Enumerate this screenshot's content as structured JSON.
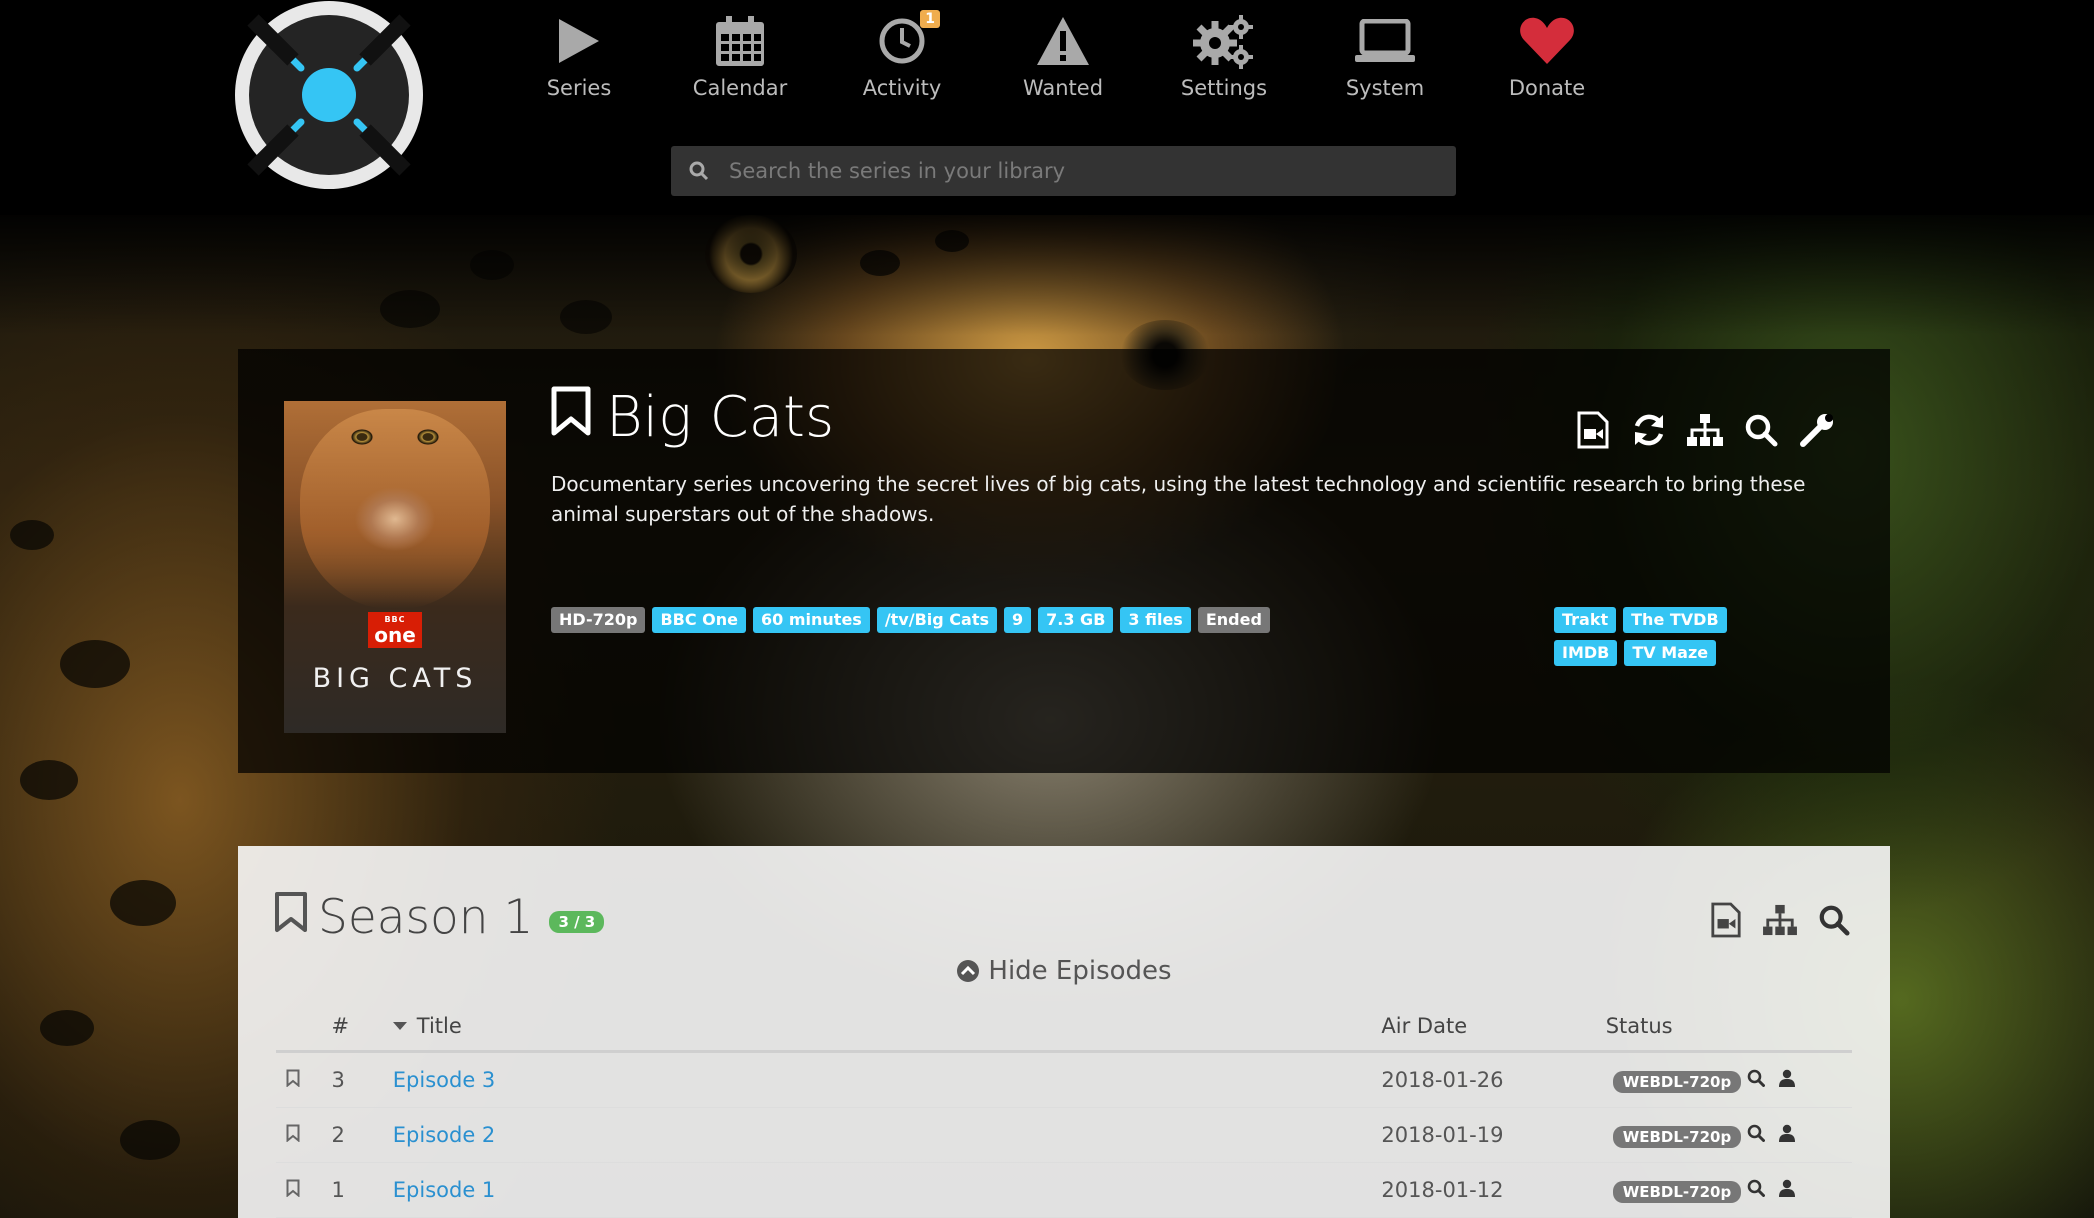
{
  "nav": {
    "items": [
      {
        "key": "series",
        "label": "Series",
        "icon": "play-icon"
      },
      {
        "key": "calendar",
        "label": "Calendar",
        "icon": "calendar-icon"
      },
      {
        "key": "activity",
        "label": "Activity",
        "icon": "clock-icon",
        "badge": "1"
      },
      {
        "key": "wanted",
        "label": "Wanted",
        "icon": "warning-icon"
      },
      {
        "key": "settings",
        "label": "Settings",
        "icon": "gears-icon"
      },
      {
        "key": "system",
        "label": "System",
        "icon": "laptop-icon"
      },
      {
        "key": "donate",
        "label": "Donate",
        "icon": "heart-icon"
      }
    ]
  },
  "search": {
    "placeholder": "Search the series in your library",
    "value": ""
  },
  "series": {
    "title": "Big Cats",
    "overview": "Documentary series uncovering the secret lives of big cats, using the latest technology and scientific research to bring these animal superstars out of the shadows.",
    "poster": {
      "network_logo_top": "BBC",
      "network_logo_bottom": "one",
      "title": "BIG CATS"
    },
    "labels": {
      "quality": "HD-720p",
      "network": "BBC One",
      "runtime": "60 minutes",
      "path": "/tv/Big Cats",
      "episode_count": "9",
      "size": "7.3 GB",
      "files": "3 files",
      "status": "Ended"
    },
    "links": [
      "Trakt",
      "The TVDB",
      "IMDB",
      "TV Maze"
    ]
  },
  "season": {
    "title": "Season 1",
    "count": "3 / 3",
    "toggle_label": "Hide Episodes",
    "columns": {
      "number": "#",
      "title": "Title",
      "air_date": "Air Date",
      "status": "Status"
    },
    "episodes": [
      {
        "number": "3",
        "title": "Episode 3",
        "air_date": "2018-01-26",
        "quality": "WEBDL-720p"
      },
      {
        "number": "2",
        "title": "Episode 2",
        "air_date": "2018-01-19",
        "quality": "WEBDL-720p"
      },
      {
        "number": "1",
        "title": "Episode 1",
        "air_date": "2018-01-12",
        "quality": "WEBDL-720p"
      }
    ]
  },
  "colors": {
    "accent": "#35c5f4",
    "donate": "#d42d3b",
    "success": "#5cb85c",
    "warning": "#f0ad4e",
    "label_default": "#777777",
    "link": "#2a90d0"
  }
}
